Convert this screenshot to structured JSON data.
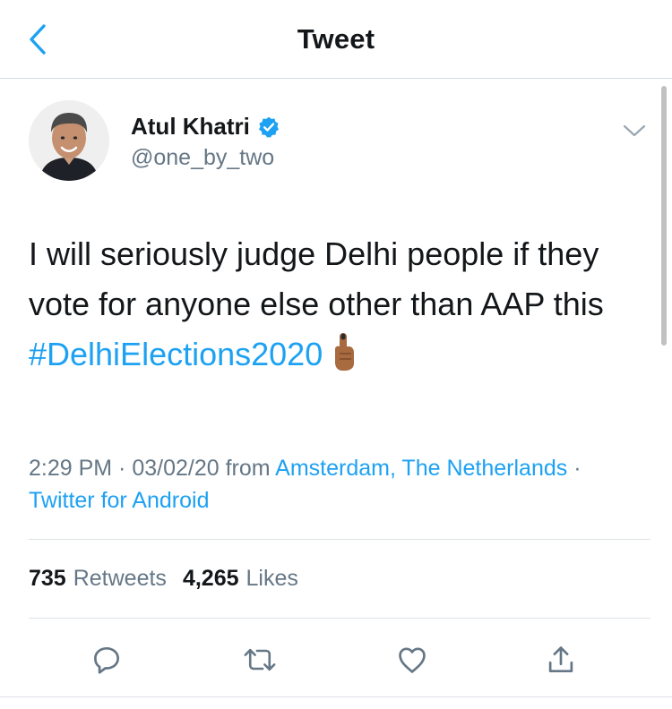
{
  "nav": {
    "title": "Tweet"
  },
  "author": {
    "name": "Atul Khatri",
    "handle": "@one_by_two",
    "verified": true
  },
  "tweet": {
    "text_before": "I will seriously judge Delhi people if they vote for anyone else other than AAP this ",
    "hashtag": "#DelhiElections2020",
    "emoji": "voting-finger"
  },
  "meta": {
    "time": "2:29 PM",
    "sep1": " · ",
    "date": "03/02/20",
    "from": " from ",
    "location": "Amsterdam, The Netherlands",
    "sep2": " · ",
    "source": "Twitter for Android"
  },
  "stats": {
    "retweets_count": "735",
    "retweets_label": "Retweets",
    "likes_count": "4,265",
    "likes_label": "Likes"
  },
  "actions": [
    "reply-icon",
    "retweet-icon",
    "like-icon",
    "share-icon"
  ],
  "colors": {
    "accent": "#1da1f2",
    "muted": "#657786",
    "text": "#14171a",
    "divider": "#dde2e6"
  }
}
